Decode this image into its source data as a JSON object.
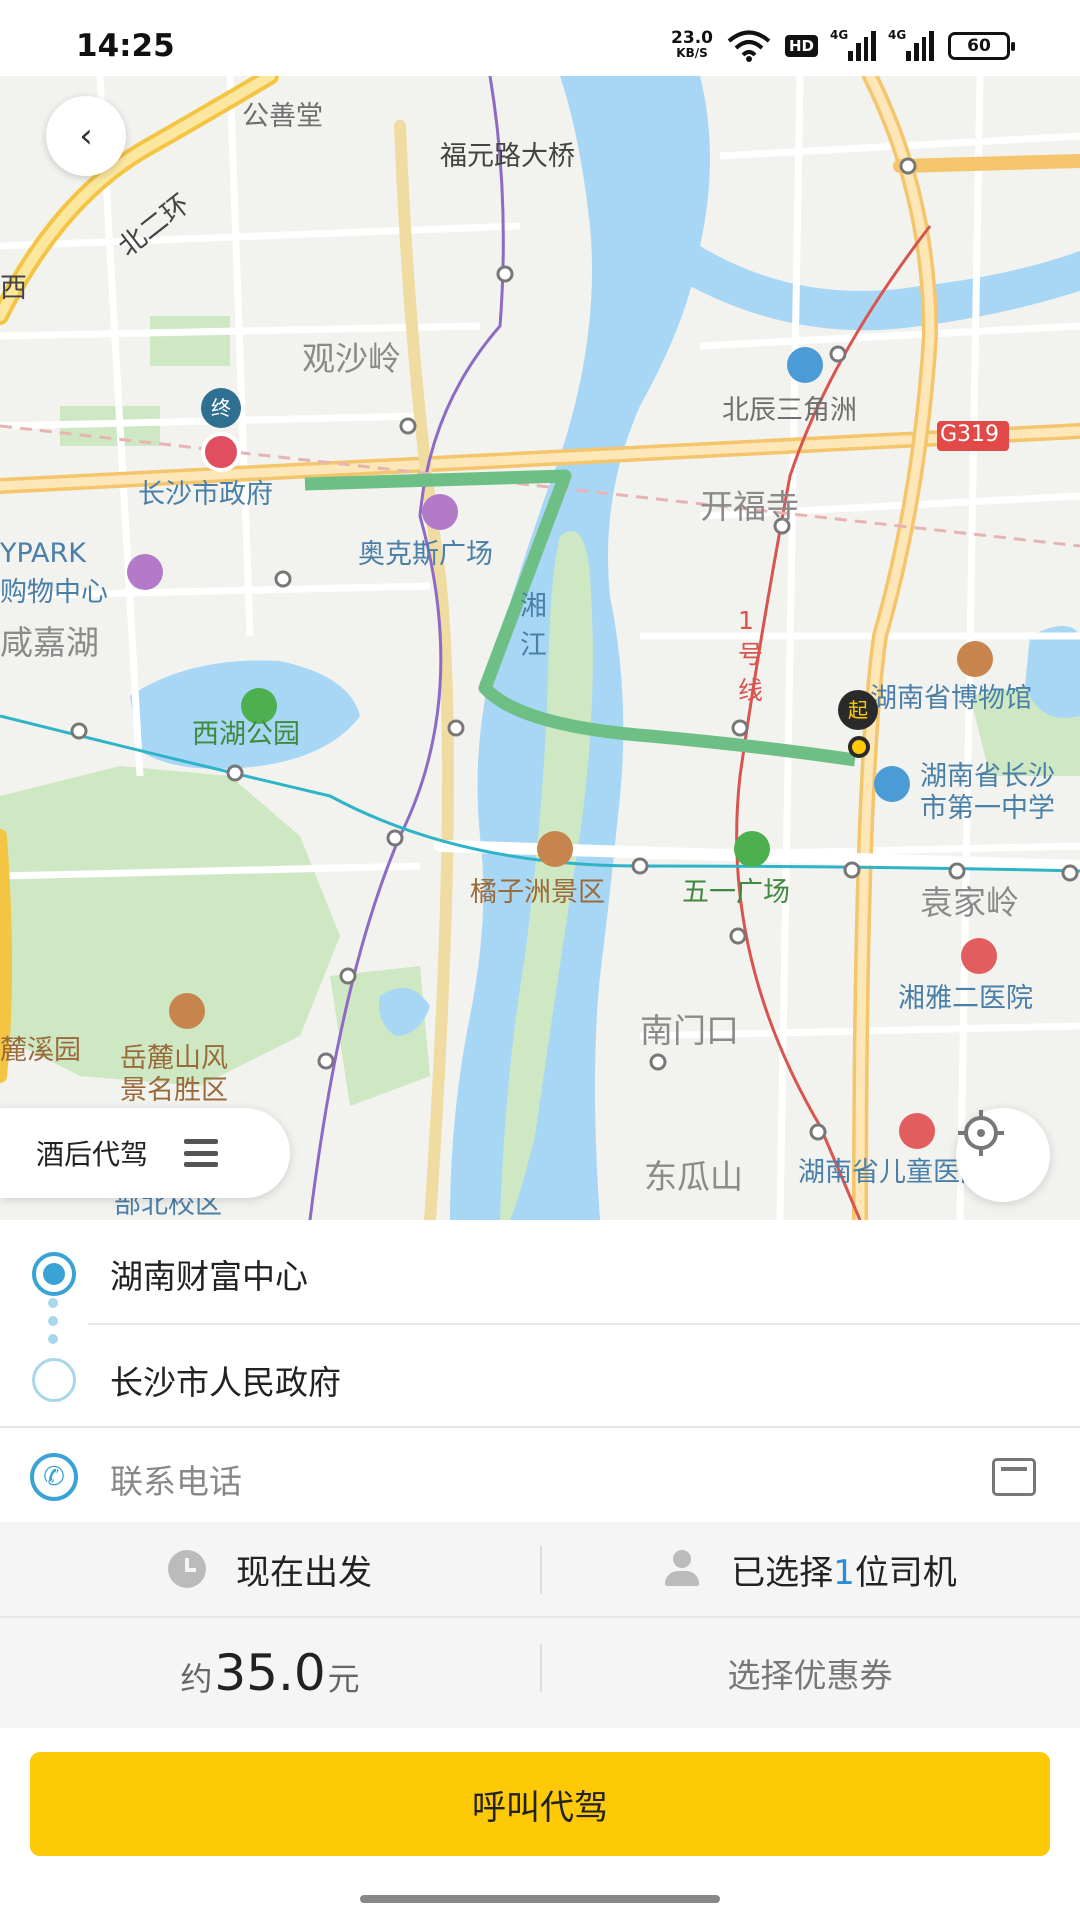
{
  "status_bar": {
    "time": "14:25",
    "net_speed_value": "23.0",
    "net_speed_unit": "KB/S",
    "hd_badge": "HD",
    "sig1": "4G",
    "sig2": "4G",
    "battery": "60"
  },
  "map": {
    "labels": {
      "gongshantang": "公善堂",
      "fuyuan_bridge": "福元路大桥",
      "beierhuan": "北二环",
      "xi": "西",
      "guanshaling": "观沙岭",
      "beichen": "北辰三角洲",
      "g319": "G319",
      "city_gov": "长沙市政府",
      "kaifusi": "开福寺",
      "aokesi": "奥克斯广场",
      "ypark": "YPARK",
      "gouwu": "购物中心",
      "xianjiahu": "咸嘉湖",
      "xiangjiang": "湘江",
      "line1": "1号线",
      "museum": "湖南省博物馆",
      "xihu_park": "西湖公园",
      "no1_school_1": "湖南省长沙",
      "no1_school_2": "市第一中学",
      "juzizhou": "橘子洲景区",
      "wuyi": "五一广场",
      "yuanjialing": "袁家岭",
      "xiangya": "湘雅二医院",
      "lxyuan": "麓溪园",
      "yuelu_1": "岳麓山风",
      "yuelu_2": "景名胜区",
      "nanmenkou": "南门口",
      "dongguashan": "东瓜山",
      "children_hosp": "湖南省儿童医院",
      "campus": "部北校区"
    },
    "start_marker": "起",
    "end_marker": "终",
    "route_color": "#6dbf86",
    "water_color": "#a7d7f5",
    "park_color": "#cfe8c4",
    "drive_pill_label": "酒后代驾"
  },
  "form": {
    "start_address": "湖南财富中心",
    "end_address": "长沙市人民政府",
    "phone_placeholder": "联系电话",
    "depart_label": "现在出发",
    "driver_prefix": "已选择",
    "driver_count": "1",
    "driver_suffix": "位司机",
    "price_prefix": "约",
    "price_value": "35.0",
    "price_unit": "元",
    "coupon_label": "选择优惠券",
    "call_button": "呼叫代驾",
    "accent_color": "#fec907",
    "blue_color": "#3aa3d6"
  }
}
